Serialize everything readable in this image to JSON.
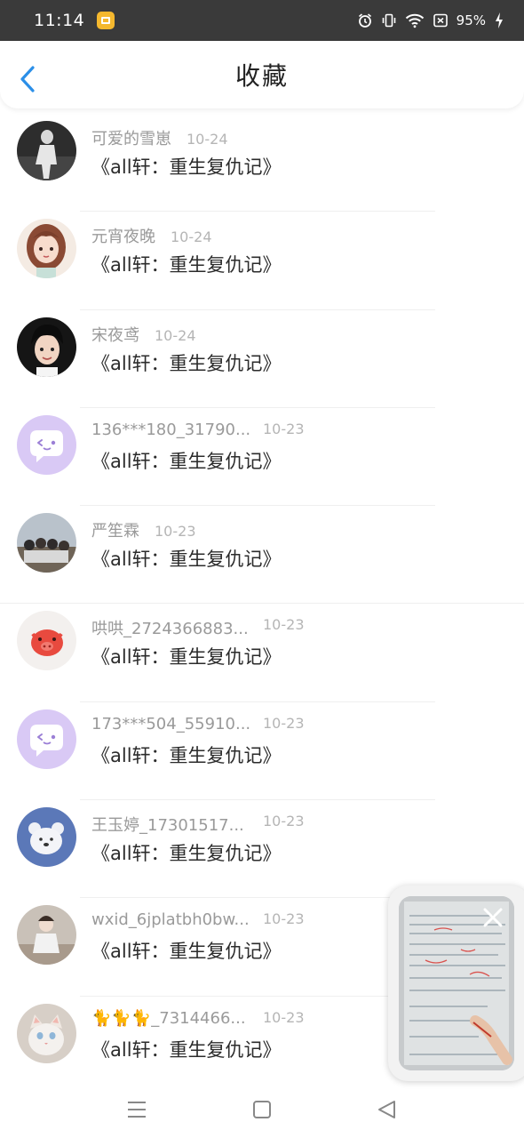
{
  "status_bar": {
    "time": "11:14",
    "battery": "95%",
    "icons": [
      "app-notification-icon",
      "alarm-icon",
      "vibrate-icon",
      "wifi-icon",
      "battery-saver-icon",
      "charging-icon"
    ]
  },
  "header": {
    "title": "收藏",
    "back_icon": "chevron-left-icon",
    "accent_color": "#2b8fe8"
  },
  "items": [
    {
      "username": "可爱的雪崽",
      "date": "10-24",
      "title": "《all轩：重生复仇记》"
    },
    {
      "username": "元宵夜晚",
      "date": "10-24",
      "title": "《all轩：重生复仇记》"
    },
    {
      "username": "宋夜鸢",
      "date": "10-24",
      "title": "《all轩：重生复仇记》"
    },
    {
      "username": "136***180_31790...",
      "date": "10-23",
      "title": "《all轩：重生复仇记》"
    },
    {
      "username": "严笙霖",
      "date": "10-23",
      "title": "《all轩：重生复仇记》"
    },
    {
      "username": "哄哄_2724366883...",
      "date": "10-23",
      "title": "《all轩：重生复仇记》"
    },
    {
      "username": "173***504_55910...",
      "date": "10-23",
      "title": "《all轩：重生复仇记》"
    },
    {
      "username": "王玉婷_17301517...",
      "date": "10-23",
      "title": "《all轩：重生复仇记》"
    },
    {
      "username": "wxid_6jplatbh0bw...",
      "date": "10-23",
      "title": "《all轩：重生复仇记》"
    },
    {
      "username": "🐈🐈🐈_7314466...",
      "date": "10-23",
      "title": "《all轩：重生复仇记》"
    }
  ],
  "floating_window": {
    "close_icon": "close-icon"
  },
  "nav_bar": {
    "icons": [
      "menu-icon",
      "home-square-icon",
      "back-triangle-icon"
    ]
  }
}
